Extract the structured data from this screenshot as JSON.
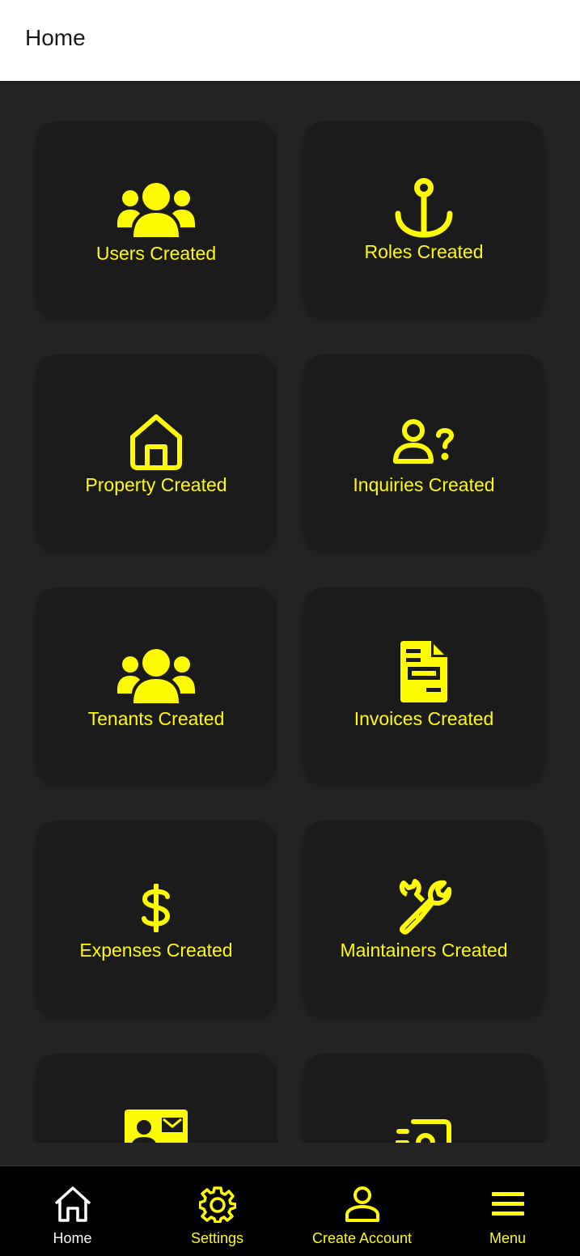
{
  "header": {
    "title": "Home"
  },
  "colors": {
    "accent": "#fffb00",
    "background": "#242424",
    "card": "#1b1b1b",
    "header_bg": "#ffffff",
    "nav_bg": "#000000"
  },
  "cards": [
    {
      "label": "Users Created",
      "icon": "users-icon"
    },
    {
      "label": "Roles Created",
      "icon": "anchor-icon"
    },
    {
      "label": "Property Created",
      "icon": "home-icon"
    },
    {
      "label": "Inquiries Created",
      "icon": "user-question-icon"
    },
    {
      "label": "Tenants Created",
      "icon": "users-icon"
    },
    {
      "label": "Invoices Created",
      "icon": "invoice-icon"
    },
    {
      "label": "Expenses Created",
      "icon": "dollar-icon"
    },
    {
      "label": "Maintainers Created",
      "icon": "wrench-icon"
    },
    {
      "label": "",
      "icon": "contact-card-icon"
    },
    {
      "label": "",
      "icon": "money-icon"
    }
  ],
  "bottom_nav": {
    "items": [
      {
        "label": "Home",
        "icon": "home-outline-icon",
        "active": true
      },
      {
        "label": "Settings",
        "icon": "gear-icon",
        "active": false
      },
      {
        "label": "Create Account",
        "icon": "person-icon",
        "active": false
      },
      {
        "label": "Menu",
        "icon": "menu-icon",
        "active": false
      }
    ]
  }
}
